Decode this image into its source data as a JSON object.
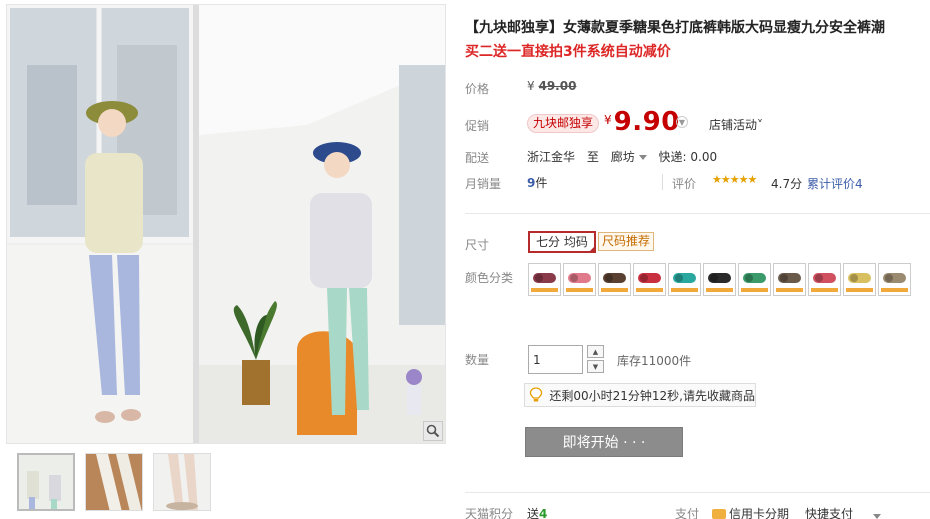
{
  "gallery": {
    "zoom_icon": "magnifier-icon",
    "thumb_count": 3
  },
  "product": {
    "title": "【九块邮独享】女薄款夏季糖果色打底裤韩版大码显瘦九分安全裤潮",
    "subtitle": "买二送一直接拍3件系统自动减价"
  },
  "price": {
    "label": "价格",
    "currency": "¥",
    "original": "49.00"
  },
  "promo": {
    "label": "促销",
    "tag": "九块邮独享",
    "currency": "¥",
    "price": "9.90",
    "store_activity": "店铺活动",
    "store_activity_chevron": "˅"
  },
  "shipping": {
    "label": "配送",
    "from": "浙江金华",
    "to_word": "至",
    "to": "廊坊",
    "fee": "快递: 0.00"
  },
  "sales": {
    "label": "月销量",
    "count": "9",
    "unit": "件",
    "rating_label": "评价",
    "stars": "★★★★★",
    "score": "4.7分",
    "reviews": "累计评价4"
  },
  "options": {
    "size_label": "尺寸",
    "size_value": "七分 均码",
    "size_recommend": "尺码推荐",
    "color_label": "颜色分类",
    "colors": [
      "#8b3a4a",
      "#e07a8a",
      "#5a4030",
      "#c83040",
      "#2aa8a0",
      "#2a2a2a",
      "#3a9a6a",
      "#6a5a4a",
      "#d05060",
      "#d8c060",
      "#9a8a70"
    ],
    "band_color": "#f2a93b"
  },
  "quantity": {
    "label": "数量",
    "value": "1",
    "up": "▲",
    "down": "▼",
    "stock": "库存11000件"
  },
  "reminder": {
    "icon": "bulb-icon",
    "text": "还剩00小时21分钟12秒,请先收藏商品"
  },
  "action": {
    "coming_soon": "即将开始 · · ·"
  },
  "footer": {
    "points_label": "天猫积分",
    "points_prefix": "送",
    "points_value": "4",
    "pay_label": "支付",
    "credit_card": "信用卡分期",
    "quick_pay": "快捷支付"
  }
}
